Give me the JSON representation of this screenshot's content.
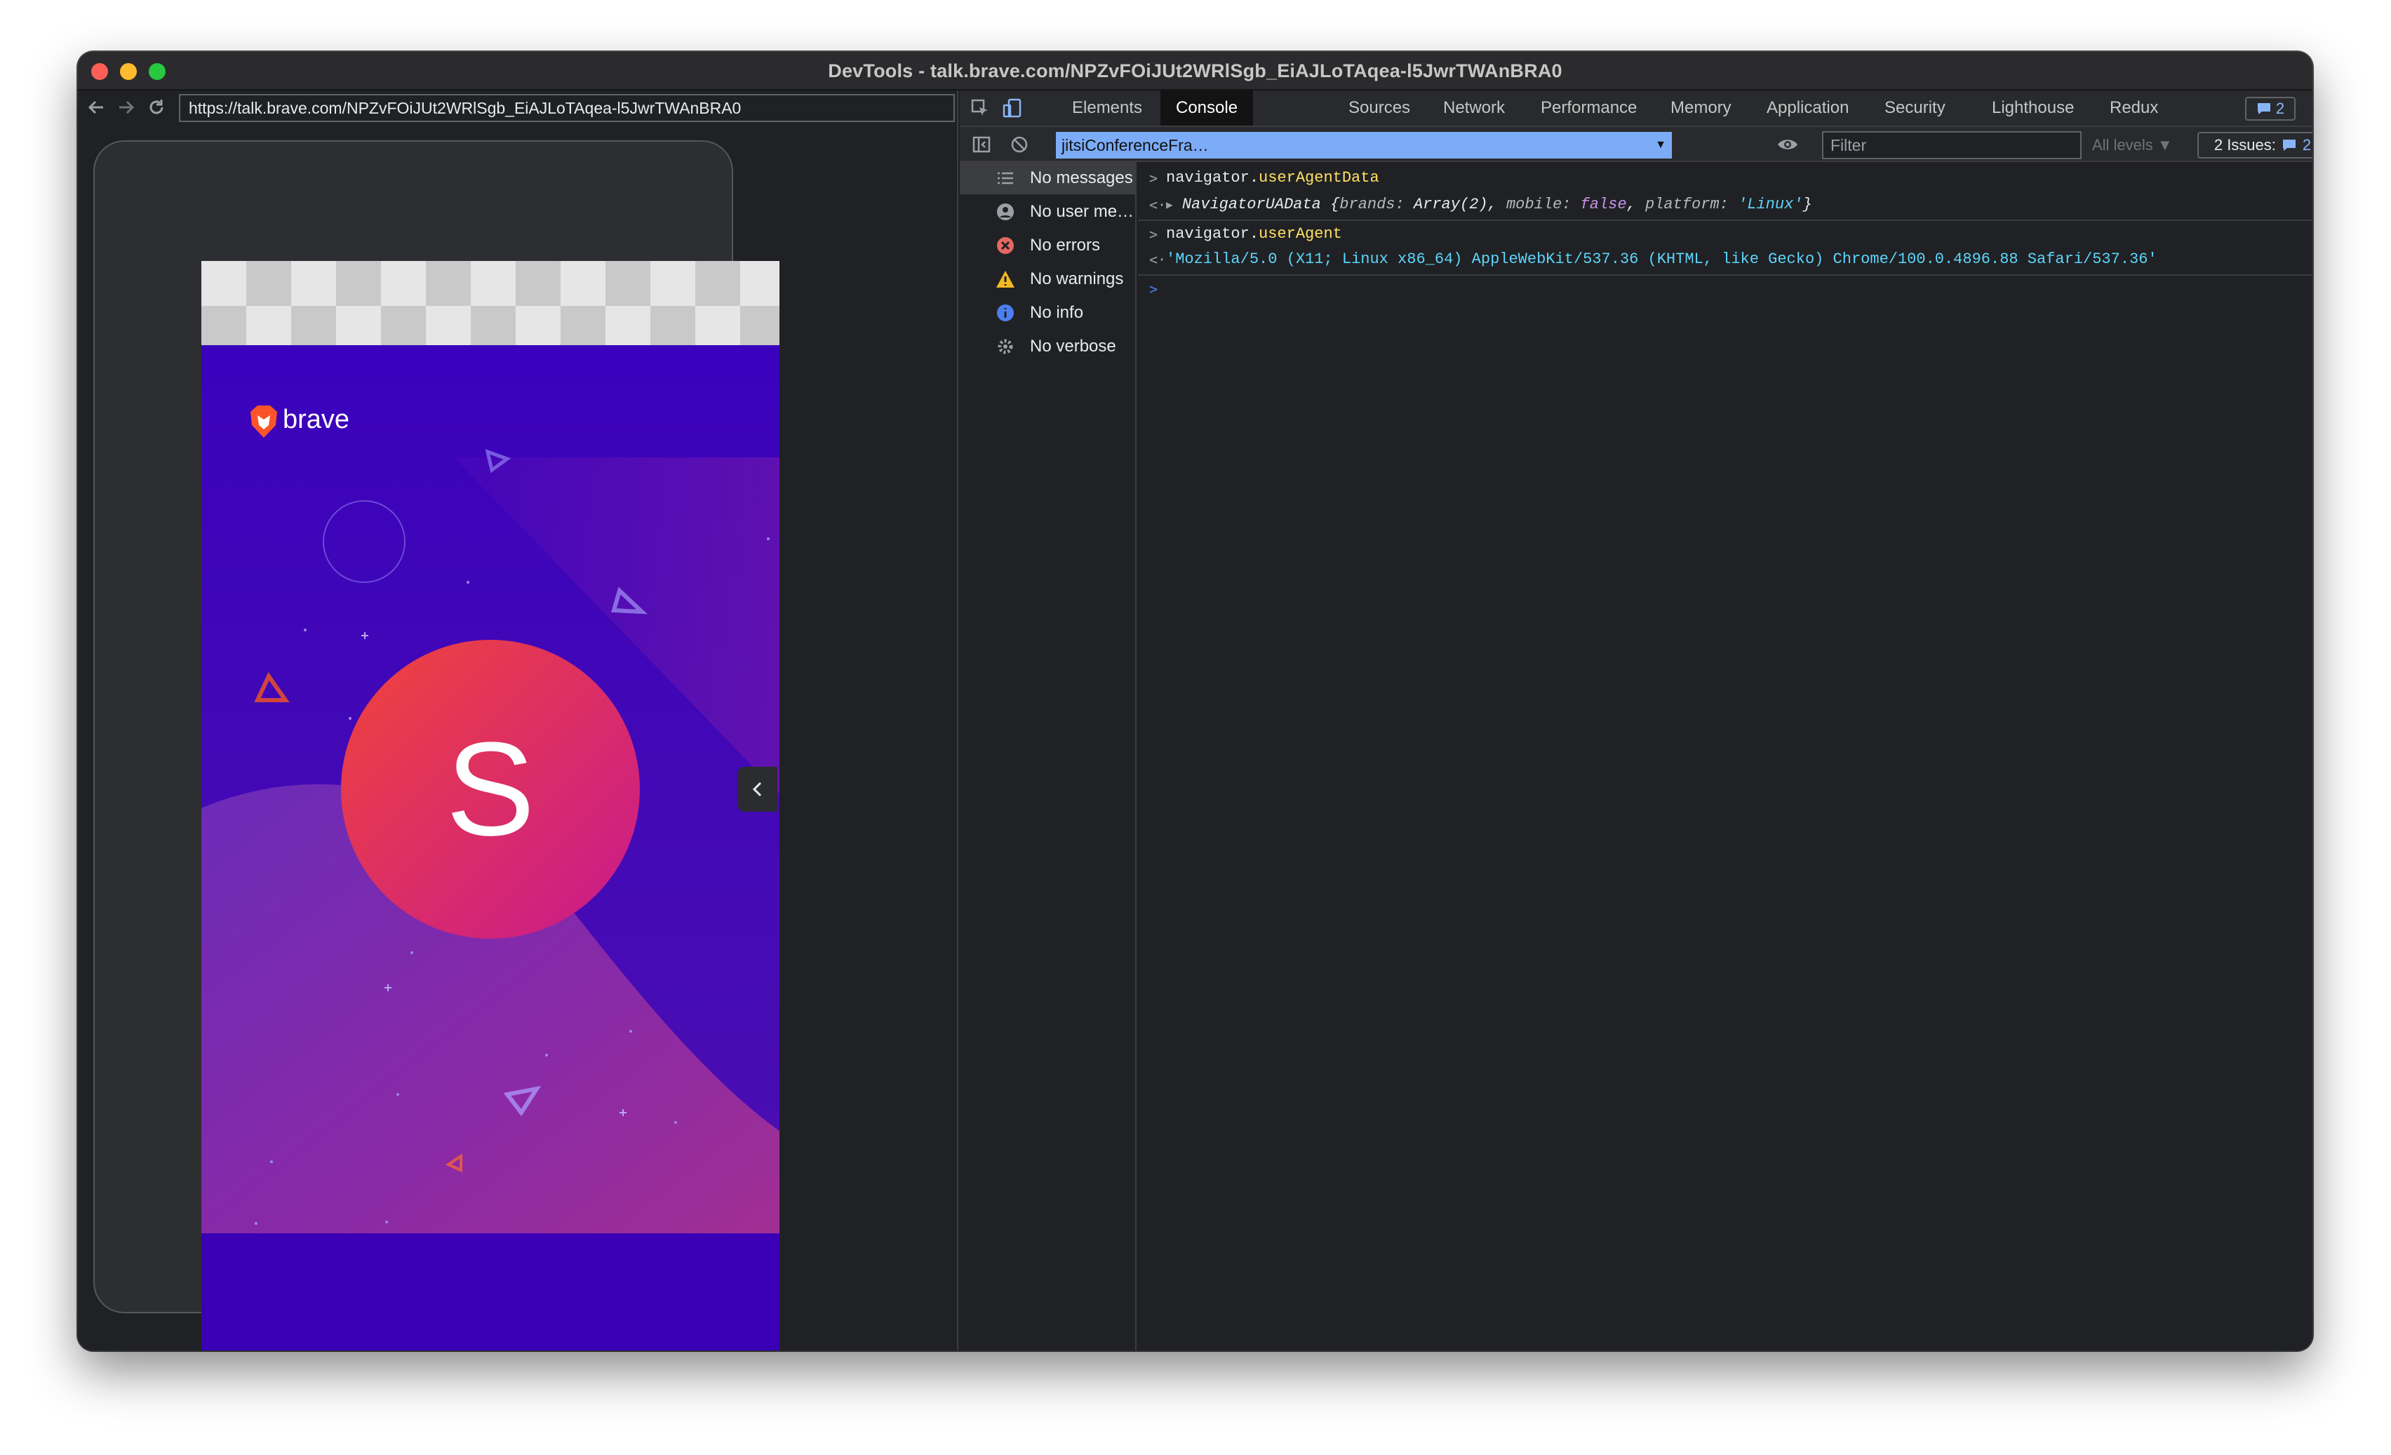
{
  "window": {
    "title": "DevTools - talk.brave.com/NPZvFOiJUt2WRlSgb_EiAJLoTAqea-l5JwrTWAnBRA0",
    "traffic_lights": [
      "#ff5f57",
      "#febc2e",
      "#28c840"
    ]
  },
  "browser": {
    "url": "https://talk.brave.com/NPZvFOiJUt2WRlSgb_EiAJLoTAqea-l5JwrTWAnBRA0",
    "nav_icons": [
      "back-arrow-icon",
      "forward-arrow-icon",
      "reload-icon"
    ]
  },
  "page": {
    "brand": "brave",
    "avatar_letter": "S",
    "colors": {
      "background": "#3b05b8",
      "avatar_start": "#f0443a",
      "avatar_end": "#c8198f",
      "brand_orange": "#fb542b"
    }
  },
  "devtools": {
    "tabs": [
      {
        "label": "Elements"
      },
      {
        "label": "Console"
      },
      {
        "label": "Sources"
      },
      {
        "label": "Network"
      },
      {
        "label": "Performance"
      },
      {
        "label": "Memory"
      },
      {
        "label": "Application"
      },
      {
        "label": "Security"
      },
      {
        "label": "Lighthouse"
      },
      {
        "label": "Redux"
      }
    ],
    "active_tab": "Console",
    "messages_badge": "2",
    "context": "jitsiConferenceFra…",
    "filter_placeholder": "Filter",
    "levels": "All levels ▼",
    "issues_label": "2 Issues:",
    "issues_count": "2",
    "sidebar": [
      {
        "label": "No messages",
        "icon": "list-icon"
      },
      {
        "label": "No user me…",
        "icon": "user-icon"
      },
      {
        "label": "No errors",
        "icon": "error-icon"
      },
      {
        "label": "No warnings",
        "icon": "warning-icon"
      },
      {
        "label": "No info",
        "icon": "info-icon"
      },
      {
        "label": "No verbose",
        "icon": "gear-icon"
      }
    ],
    "console": {
      "cmd1_obj": "navigator.",
      "cmd1_prop": "userAgentData",
      "res1_class": "NavigatorUAData",
      "res1_open": " {",
      "res1_k1": "brands:",
      "res1_v1": " Array(2)",
      "res1_k2": "mobile:",
      "res1_v2": " false",
      "res1_k3": "platform:",
      "res1_v3": " 'Linux'",
      "res1_close": "}",
      "cmd2_obj": "navigator.",
      "cmd2_prop": "userAgent",
      "res2": "'Mozilla/5.0 (X11; Linux x86_64) AppleWebKit/537.36 (KHTML, like Gecko) Chrome/100.0.4896.88 Safari/537.36'"
    }
  }
}
